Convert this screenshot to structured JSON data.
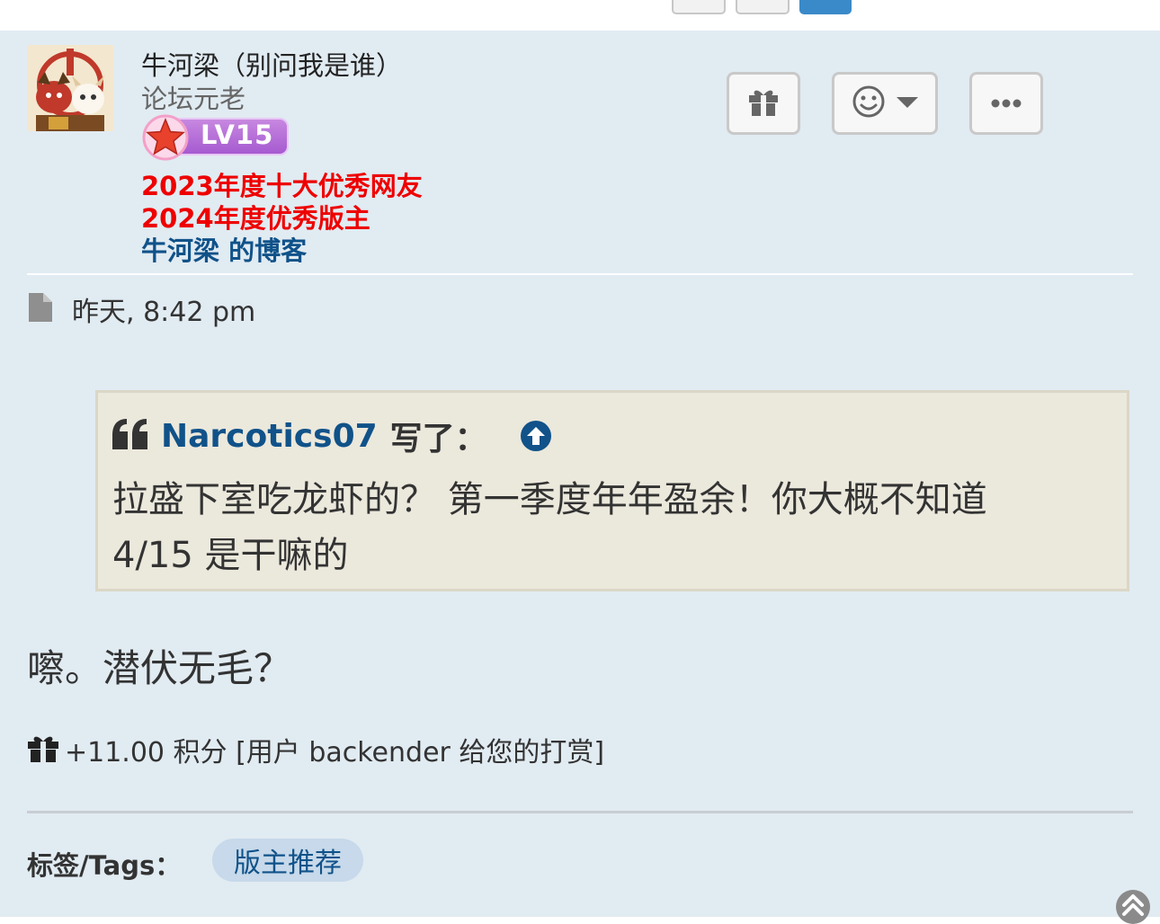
{
  "post": {
    "author": {
      "username": "牛河梁（别问我是谁）",
      "rank": "论坛元老",
      "level_badge": "LV15",
      "honors": [
        "2023年度十大优秀网友",
        "2024年度优秀版主"
      ],
      "blog_link": "牛河梁 的博客"
    },
    "actions": [
      "gift-icon",
      "smiley-icon",
      "more-icon"
    ],
    "timestamp": "昨天, 8:42 pm",
    "quote": {
      "author": "Narcotics07",
      "wrote_label": "写了：",
      "lines": [
        "拉盛下室吃龙虾的？ 第一季度年年盈余！你大概不知道",
        "4/15 是干嘛的"
      ]
    },
    "content": "嚓。潜伏无毛？",
    "reward": "+11.00 积分 [用户 backender 给您的打赏]",
    "tags": {
      "label": "标签/Tags：",
      "items": [
        "版主推荐"
      ]
    }
  },
  "colors": {
    "post_bg": "#e1ebf2",
    "link_blue": "#105289",
    "honor_red": "#ee0000",
    "quote_bg": "#ebe8dc",
    "tag_bg": "#c7d9ea"
  }
}
